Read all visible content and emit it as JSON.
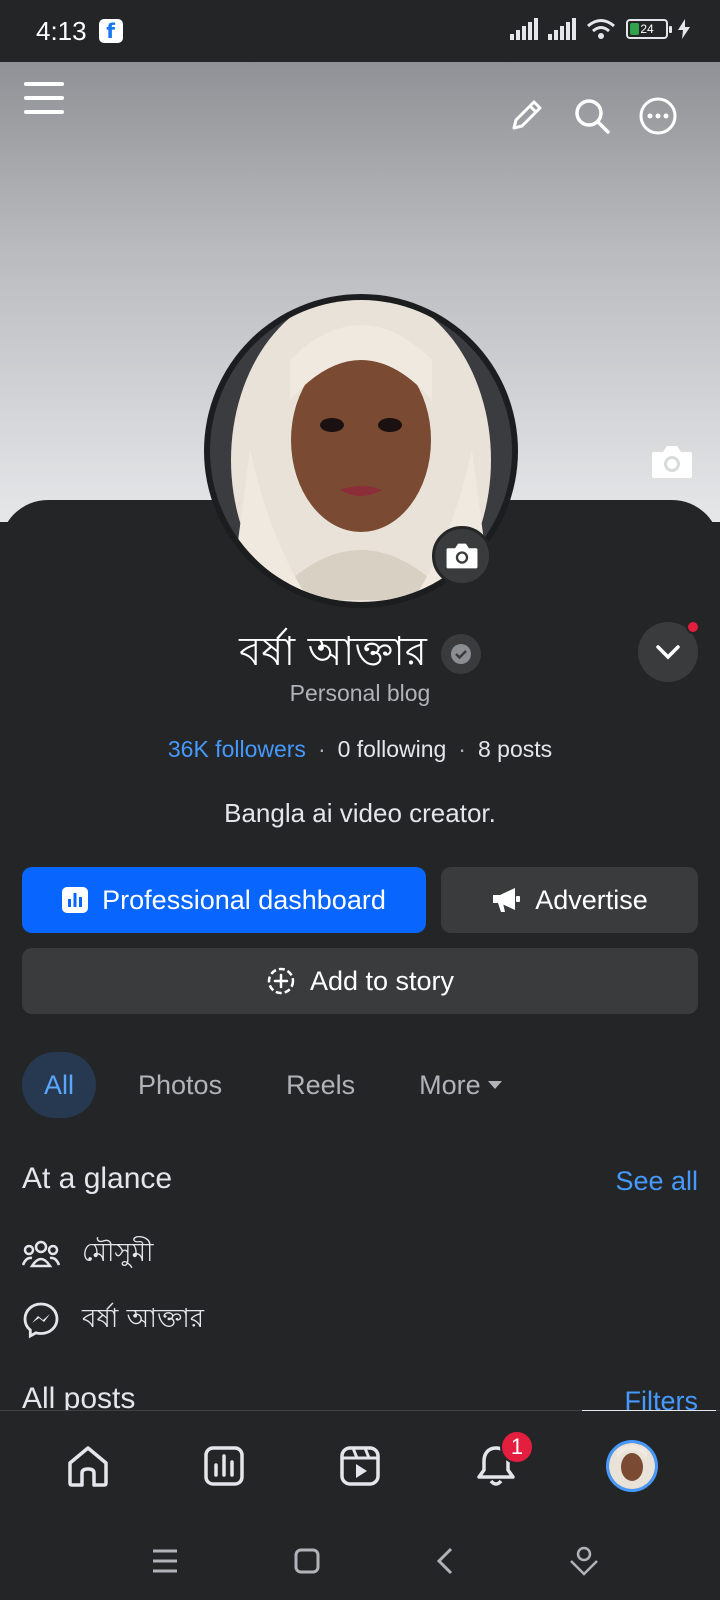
{
  "status_bar": {
    "time": "4:13",
    "battery": "24"
  },
  "profile": {
    "name": "বর্ষা আক্তার",
    "category": "Personal blog",
    "followers": "36K followers",
    "following": "0 following",
    "posts": "8 posts",
    "separator": "·",
    "bio": "Bangla ai video creator."
  },
  "actions": {
    "dashboard_label": "Professional dashboard",
    "advertise_label": "Advertise",
    "story_label": "Add to story"
  },
  "tabs": [
    {
      "label": "All",
      "active": true
    },
    {
      "label": "Photos",
      "active": false
    },
    {
      "label": "Reels",
      "active": false
    },
    {
      "label": "More",
      "active": false
    }
  ],
  "at_a_glance": {
    "title": "At a glance",
    "see_all": "See all",
    "items": [
      {
        "icon": "friends-icon",
        "label": "মৌসুমী"
      },
      {
        "icon": "messenger-icon",
        "label": "বর্ষা আক্তার"
      }
    ]
  },
  "all_posts": {
    "title": "All posts",
    "filters": "Filters"
  },
  "bottom_nav": {
    "items": [
      "home-icon",
      "dashboard-icon",
      "video-icon",
      "notifications-icon",
      "profile-avatar"
    ],
    "notification_count": "1"
  },
  "colors": {
    "accent": "#0866ff",
    "link": "#4599ff",
    "badge": "#e41e3f",
    "background": "#242526"
  }
}
